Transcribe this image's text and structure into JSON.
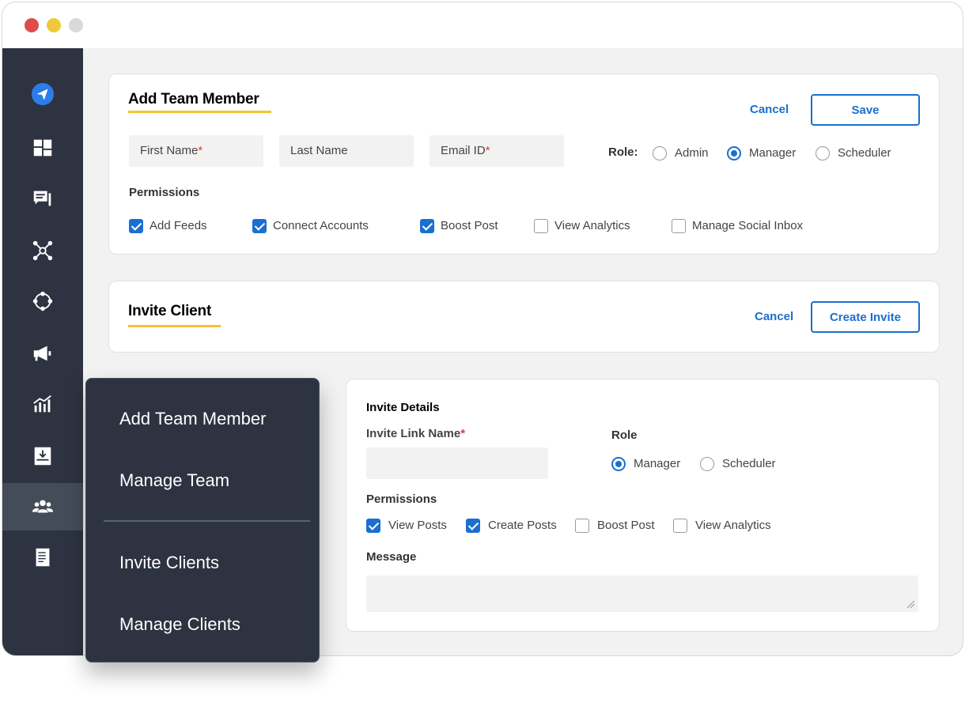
{
  "sidebar": {
    "icons": [
      "logo-send-icon",
      "dashboard-icon",
      "feeds-icon",
      "network-icon",
      "connections-icon",
      "megaphone-icon",
      "analytics-icon",
      "inbox-icon",
      "team-icon",
      "document-icon"
    ],
    "active_index": 8
  },
  "add_team_member": {
    "title": "Add Team Member",
    "cancel_label": "Cancel",
    "save_label": "Save",
    "first_name_placeholder": "First Name",
    "last_name_placeholder": "Last Name",
    "email_placeholder": "Email ID",
    "required_mark": "*",
    "role_label": "Role:",
    "roles": [
      {
        "label": "Admin",
        "checked": false
      },
      {
        "label": "Manager",
        "checked": true
      },
      {
        "label": "Scheduler",
        "checked": false
      }
    ],
    "permissions_label": "Permissions",
    "permissions": [
      {
        "label": "Add Feeds",
        "checked": true
      },
      {
        "label": "Connect Accounts",
        "checked": true
      },
      {
        "label": "Boost Post",
        "checked": true
      },
      {
        "label": "View Analytics",
        "checked": false
      },
      {
        "label": "Manage Social Inbox",
        "checked": false
      }
    ]
  },
  "invite_client": {
    "title": "Invite Client",
    "cancel_label": "Cancel",
    "create_label": "Create Invite"
  },
  "invite_details": {
    "title": "Invite Details",
    "link_name_label": "Invite Link Name",
    "required_mark": "*",
    "role_label": "Role",
    "roles": [
      {
        "label": "Manager",
        "checked": true
      },
      {
        "label": "Scheduler",
        "checked": false
      }
    ],
    "permissions_label": "Permissions",
    "permissions": [
      {
        "label": "View Posts",
        "checked": true
      },
      {
        "label": "Create Posts",
        "checked": true
      },
      {
        "label": "Boost Post",
        "checked": false
      },
      {
        "label": "View Analytics",
        "checked": false
      }
    ],
    "message_label": "Message"
  },
  "flyout_menu": {
    "items": [
      "Add Team Member",
      "Manage Team",
      "Invite Clients",
      "Manage Clients"
    ]
  },
  "colors": {
    "accent": "#1a6fd0",
    "sidebar": "#2d3340",
    "underline": "#f4c430",
    "required": "#e53935"
  }
}
